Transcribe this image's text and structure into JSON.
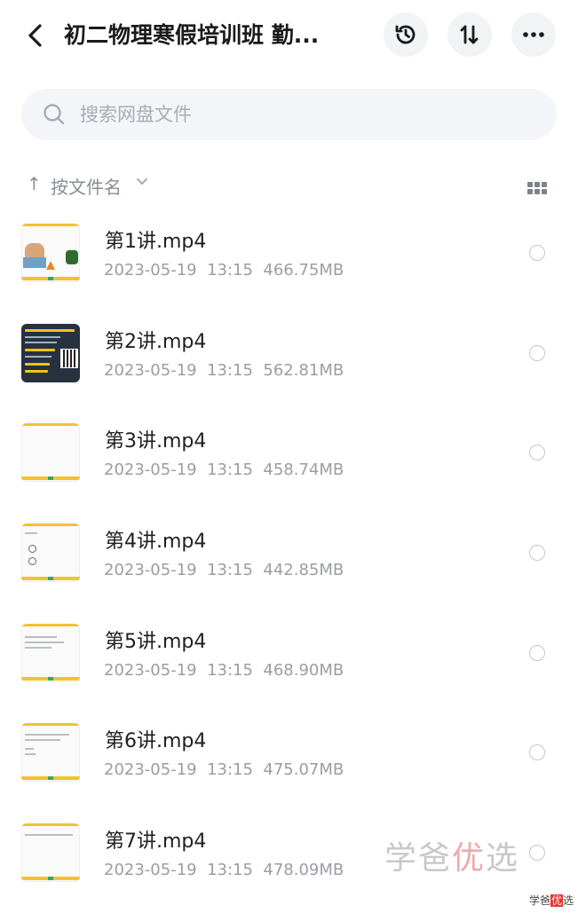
{
  "header": {
    "title": "初二物理寒假培训班 勤...",
    "back_icon": "chevron-left-icon",
    "actions": [
      {
        "name": "history",
        "icon": "history-clock-icon"
      },
      {
        "name": "sort",
        "icon": "sort-updown-icon",
        "glyph": "1↓"
      },
      {
        "name": "more",
        "icon": "more-dots-icon",
        "glyph": "•••"
      }
    ]
  },
  "search": {
    "placeholder": "搜索网盘文件",
    "icon": "search-icon"
  },
  "sortbar": {
    "arrow": "↑",
    "label": "按文件名",
    "view_icon": "grid-view-icon"
  },
  "files": [
    {
      "name": "第1讲.mp4",
      "date": "2023-05-19",
      "time": "13:15",
      "size": "466.75MB",
      "thumb": "photo"
    },
    {
      "name": "第2讲.mp4",
      "date": "2023-05-19",
      "time": "13:15",
      "size": "562.81MB",
      "thumb": "dark"
    },
    {
      "name": "第3讲.mp4",
      "date": "2023-05-19",
      "time": "13:15",
      "size": "458.74MB",
      "thumb": "slide"
    },
    {
      "name": "第4讲.mp4",
      "date": "2023-05-19",
      "time": "13:15",
      "size": "442.85MB",
      "thumb": "slide"
    },
    {
      "name": "第5讲.mp4",
      "date": "2023-05-19",
      "time": "13:15",
      "size": "468.90MB",
      "thumb": "slide"
    },
    {
      "name": "第6讲.mp4",
      "date": "2023-05-19",
      "time": "13:15",
      "size": "475.07MB",
      "thumb": "slide"
    },
    {
      "name": "第7讲.mp4",
      "date": "2023-05-19",
      "time": "13:15",
      "size": "478.09MB",
      "thumb": "slide"
    }
  ],
  "watermark": {
    "large_a": "学爸",
    "large_b": "优",
    "large_c": "选",
    "small_a": "学爸",
    "small_b": "优",
    "small_c": "选"
  },
  "colors": {
    "accent_yellow": "#f2c230",
    "text_primary": "#1f1f1f",
    "text_secondary": "#9a9da4",
    "search_bg": "#f4f5f8"
  }
}
